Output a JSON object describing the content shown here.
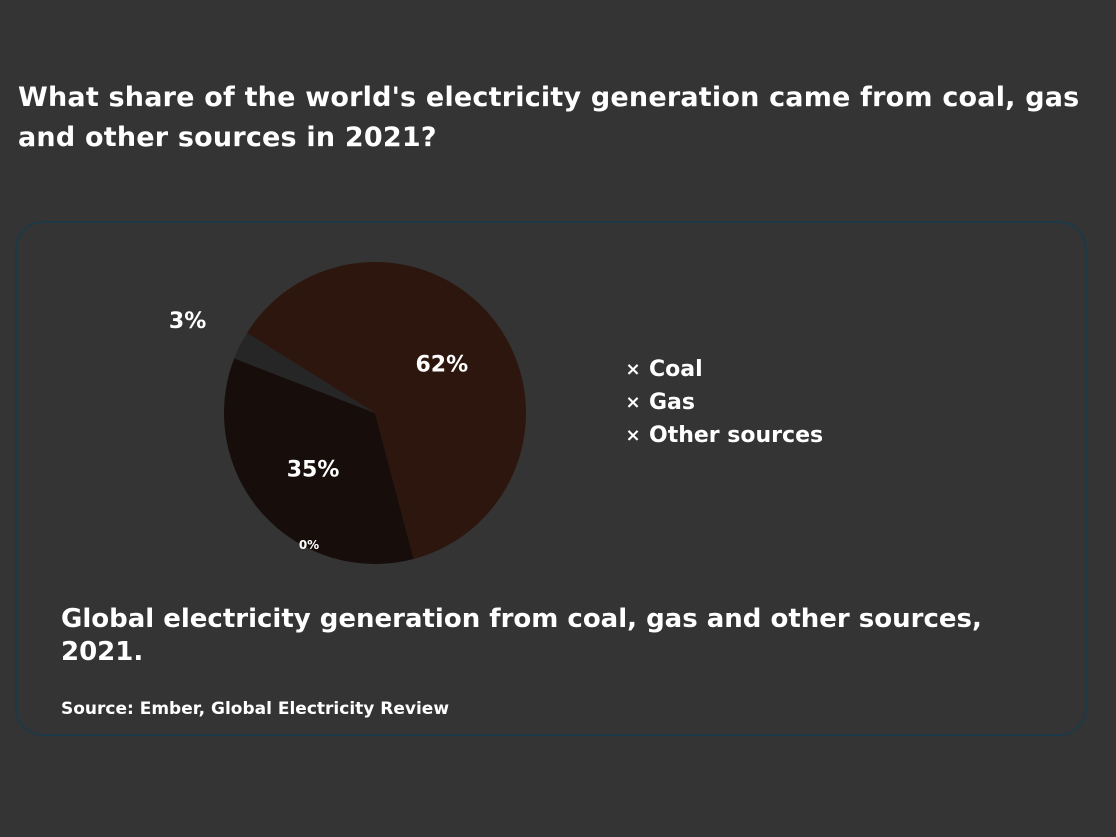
{
  "question": "What share of the world's electricity generation came from coal, gas and other sources in 2021?",
  "chart_data": {
    "type": "pie",
    "slices": [
      {
        "label": "Coal",
        "value": 62,
        "value_label": "62%",
        "color": "#2d160d"
      },
      {
        "label": "Gas",
        "value": 35,
        "value_label": "35%",
        "color": "#170e0c"
      },
      {
        "label": "Other sources",
        "value": 3,
        "value_label": "3%",
        "color": "#262626"
      }
    ],
    "unrendered_label": "0%",
    "legend": {
      "position": "right",
      "marker": "×"
    }
  },
  "caption": "Global electricity generation from coal, gas and other sources, 2021.",
  "source": "Source: Ember, Global Electricity Review"
}
